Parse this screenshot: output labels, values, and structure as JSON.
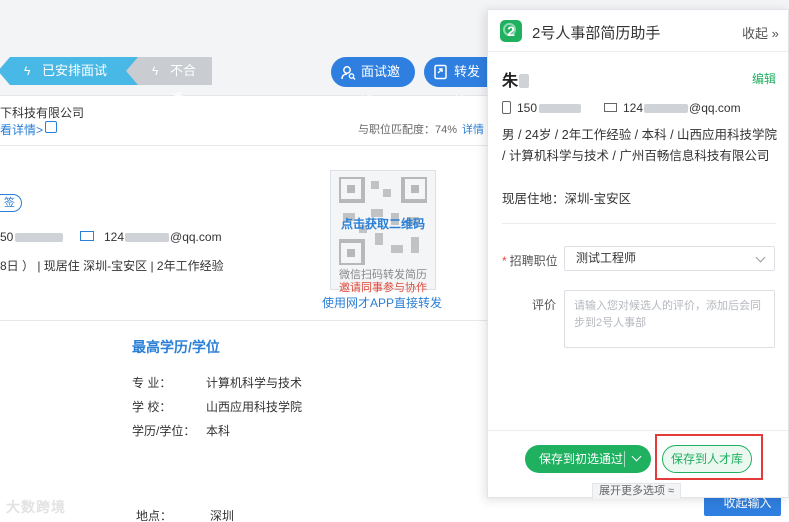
{
  "background": {
    "tags": {
      "arranged": "已安排面试",
      "rejected": "不合适"
    },
    "buttons": {
      "interview_invite": "面试邀请",
      "forward": "转发简"
    },
    "company": "下科技有限公司",
    "view_detail": "看详情>",
    "match_text": "与职位匹配度：74%",
    "match_detail": "详情",
    "chip": "签",
    "phone_prefix": "50",
    "email_prefix": "124",
    "email_suffix": "@qq.com",
    "info_line": "8日 ）  | 现居住 深圳-宝安区 | 2年工作经验",
    "qr": {
      "cta": "点击获取二维码",
      "sub1": "微信扫码转发简历",
      "sub2": "邀请同事参与协作"
    },
    "app_link": "使用网才APP直接转发",
    "education": {
      "title": "最高学历/学位",
      "major_label": "专   业：",
      "major": "计算机科学与技术",
      "school_label": "学   校：",
      "school": "山西应用科技学院",
      "degree_label": "学历/学位：",
      "degree": "本科"
    },
    "location_label": "地点：",
    "location": "深圳",
    "watermark": "大数跨境",
    "right_button": "收起输入"
  },
  "panel": {
    "title": "2号人事部简历助手",
    "collapse": "收起 »",
    "candidate_name": "朱",
    "edit": "编辑",
    "phone_prefix": "150",
    "email_prefix": "124",
    "email_suffix": "@qq.com",
    "summary": "男 / 24岁 / 2年工作经验 / 本科 / 山西应用科技学院 / 计算机科学与技术 / 广州百畅信息科技有限公司",
    "residence": "现居住地：深圳-宝安区",
    "job_label": "招聘职位",
    "job_value": "测试工程师",
    "eval_label": "评价",
    "eval_placeholder": "请输入您对候选人的评价，添加后会同步到2号人事部",
    "save_pass": "保存到初选通过",
    "save_talent": "保存到人才库",
    "expand_more": "展开更多选项 ≈"
  },
  "colors": {
    "panel_green": "#1fb060",
    "primary_blue": "#2f7fe0",
    "tag_blue": "#48b8e6",
    "highlight_red": "#e43a3a"
  }
}
